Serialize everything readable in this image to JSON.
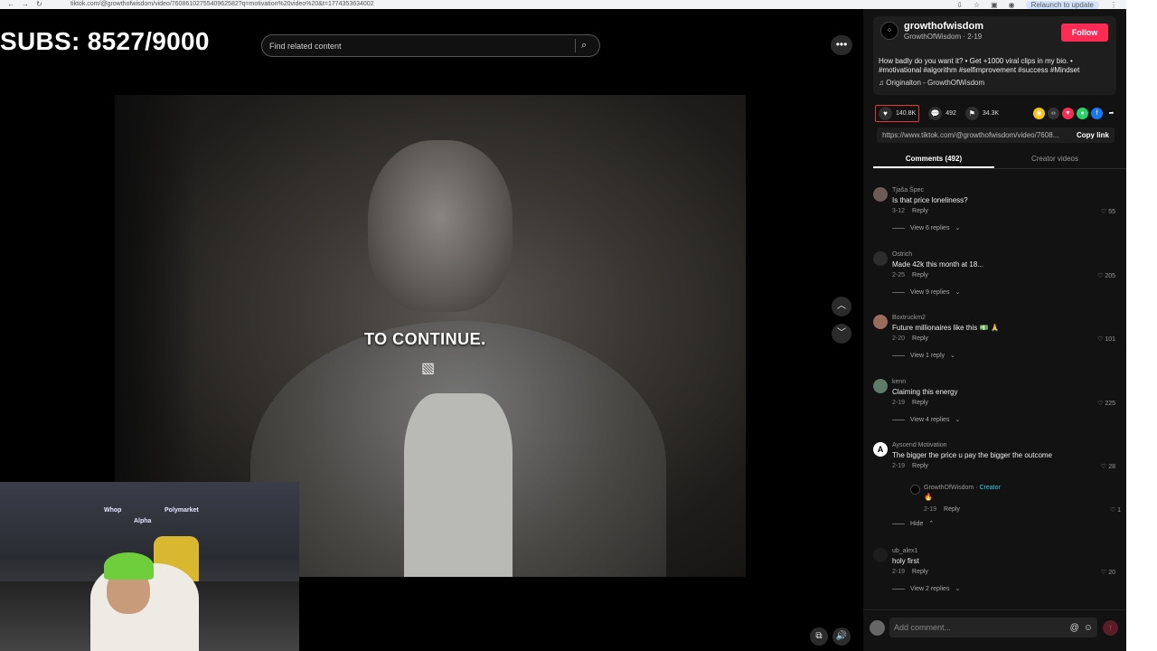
{
  "browser": {
    "url": "tiktok.com/@growthofwisdom/video/7608610275540962582?q=motivation%20video%20&t=1774353634002",
    "relaunch_label": "Relaunch to update",
    "back": "←",
    "forward": "→",
    "reload": "↻"
  },
  "overlay": {
    "subs": "SUBS: 8527/9000"
  },
  "search": {
    "placeholder": "Find related content"
  },
  "video": {
    "caption": "TO CONTINUE."
  },
  "author": {
    "avatar_text": "⁘",
    "name": "growthofwisdom",
    "subline": "GrowthOfWisdom · 2-19",
    "follow_label": "Follow",
    "description": "How badly do you want it? • Get +1000 viral clips in my bio. • #motivational #algorithm #selfimprovement #success #Mindset",
    "music": "♫  Originalton - GrowthOfWisdom"
  },
  "actions": {
    "likes": "140.8K",
    "comments": "492",
    "saves": "34.3K"
  },
  "share_colors": [
    "#f5c518",
    "#333333",
    "#fe2c55",
    "#25d366",
    "#1877f2"
  ],
  "link": {
    "url": "https://www.tiktok.com/@growthofwisdom/video/7608...",
    "copy_label": "Copy link"
  },
  "tabs": [
    {
      "label": "Comments (492)"
    },
    {
      "label": "Creator videos"
    }
  ],
  "comments": [
    {
      "user": "Tjaša Špec",
      "text": "Is that price loneliness?",
      "date": "3-12",
      "reply": "Reply",
      "likes": "55",
      "views": "View 6 replies"
    },
    {
      "user": "Ostrich",
      "text": "Made 42k this month at 18...",
      "date": "2-25",
      "reply": "Reply",
      "likes": "205",
      "views": "View 9 replies"
    },
    {
      "user": "Boxtruckm2",
      "text": "Future millionaires like this 💵 🙏",
      "date": "2-20",
      "reply": "Reply",
      "likes": "101",
      "views": "View 1 reply"
    },
    {
      "user": "kenn",
      "text": "Claiming this energy",
      "date": "2-19",
      "reply": "Reply",
      "likes": "225",
      "views": "View 4 replies"
    },
    {
      "user": "Ayscend Motivation",
      "text": "The bigger the price u pay the bigger the outcome",
      "date": "2-19",
      "reply": "Reply",
      "likes": "28",
      "sub": {
        "user": "GrowthOfWisdom",
        "tag": "· Creator",
        "text": "🔥",
        "date": "2-19",
        "reply": "Reply",
        "likes": "1"
      },
      "views": "Hide"
    },
    {
      "user": "ub_alex1",
      "text": "holy first",
      "date": "2-19",
      "reply": "Reply",
      "likes": "20",
      "views": "View 2 replies"
    }
  ],
  "input": {
    "placeholder": "Add comment...",
    "at": "@",
    "emoji": "☺"
  },
  "webcam": {
    "sign1": "Whop",
    "sign2": "Polymarket",
    "sign3": "Alpha"
  }
}
